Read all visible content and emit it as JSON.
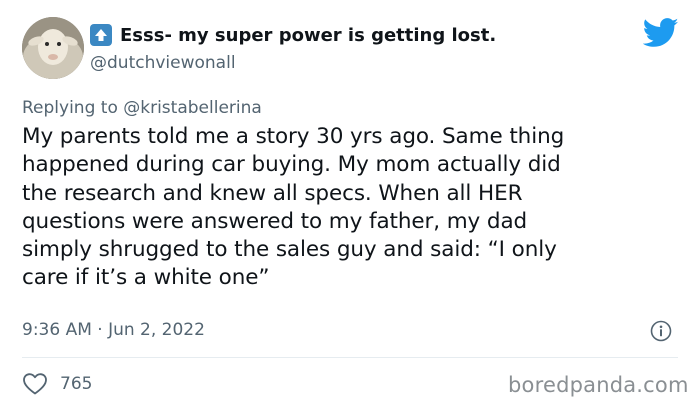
{
  "author": {
    "display_name": "Esss- my super power is getting lost.",
    "handle": "@dutchviewonall"
  },
  "reply": {
    "prefix": "Replying to",
    "mention": "@kristabellerina"
  },
  "tweet": {
    "lines": [
      "My parents told me a story 30 yrs ago. Same thing",
      "happened during car buying. My mom actually did",
      "the research and knew all specs. When all HER",
      "questions were answered to my father, my dad",
      "simply shrugged to the sales guy and said: “I only",
      "care if it’s a white one”"
    ],
    "timestamp": "9:36 AM · Jun 2, 2022",
    "like_count": "765"
  },
  "watermark": "boredpanda.com",
  "icons": {
    "brand": "twitter-bird-icon",
    "emoji": "up-arrow-emoji-icon",
    "info": "info-icon",
    "like": "heart-icon",
    "avatar": "sheep-avatar"
  },
  "colors": {
    "twitter_blue": "#1d9bf0",
    "emoji_blue": "#3b88c3",
    "text_primary": "#0f1419",
    "text_secondary": "#536471",
    "divider": "#e6ecf0",
    "watermark": "#8a8f93"
  }
}
